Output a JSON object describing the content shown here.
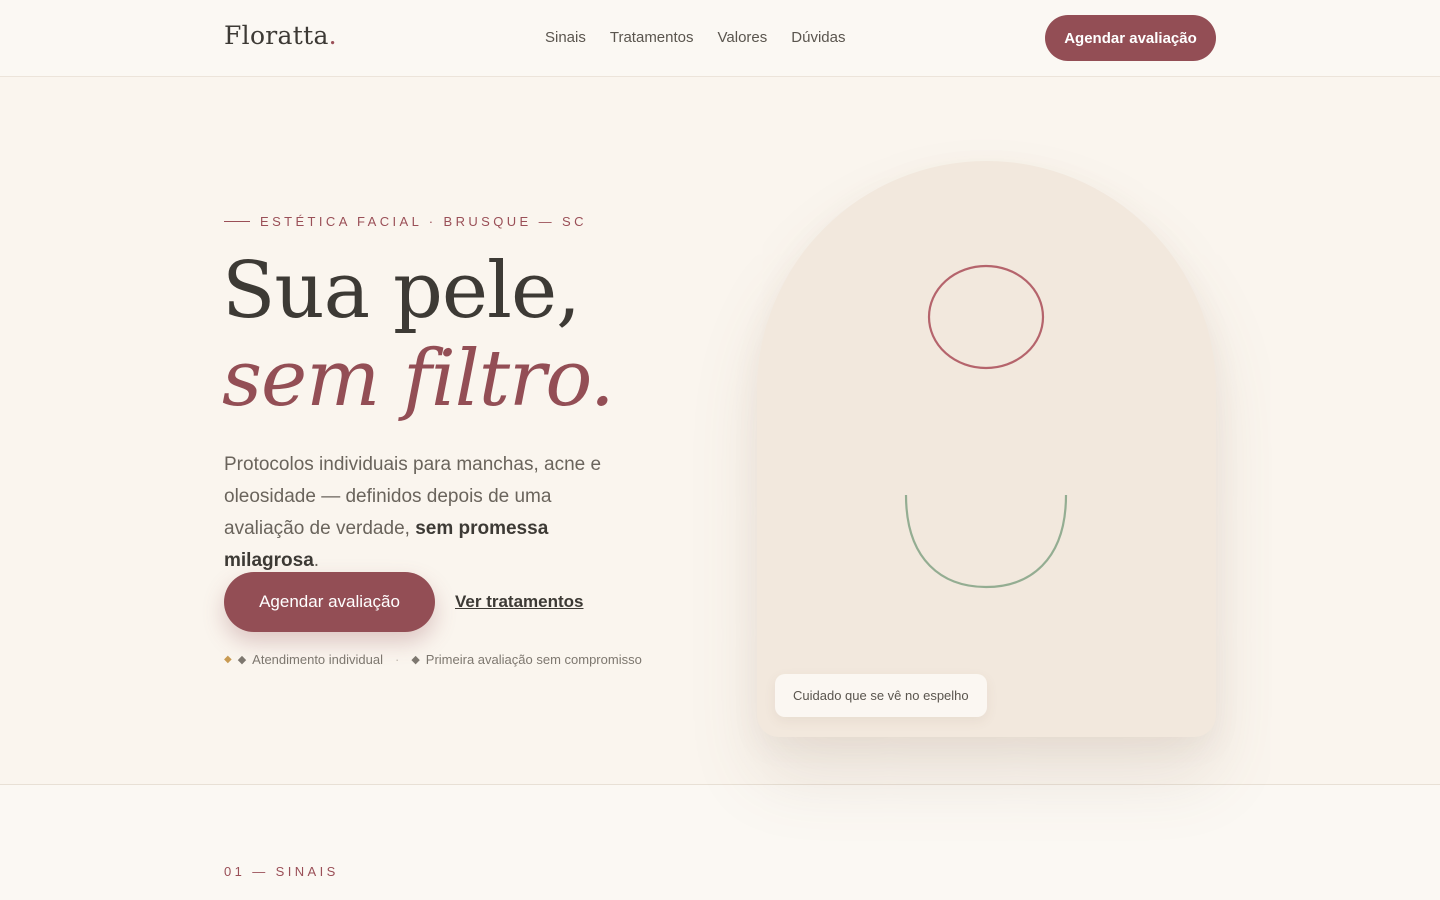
{
  "header": {
    "logo": "Floratta",
    "logo_dot": ".",
    "nav": [
      "Sinais",
      "Tratamentos",
      "Valores",
      "Dúvidas"
    ],
    "cta_label": "Agendar avaliação"
  },
  "hero": {
    "eyebrow": "ESTÉTICA FACIAL · BRUSQUE — SC",
    "headline_line1": "Sua pele,",
    "headline_line2": "sem filtro.",
    "lead_text": "Protocolos individuais para manchas, acne e oleosidade — definidos depois de uma avaliação de verdade, ",
    "lead_strong": "sem promessa milagrosa",
    "lead_end": ".",
    "cta_label": "Agendar avaliação",
    "secondary_label": "Ver tratamentos",
    "trust_items": [
      "Atendimento individual",
      "Primeira avaliação sem compromisso"
    ],
    "trust_separator": "·",
    "diamond": "◆"
  },
  "arch": {
    "badge": "Cuidado que se vê no espelho"
  },
  "next_section": {
    "label": "01 — SINAIS"
  },
  "colors": {
    "brand": "#934e55",
    "background": "#faf5ee",
    "arch": "#f2e8dd",
    "circle_stroke": "#b5646c",
    "smile_stroke": "#94ad92",
    "accent_gold": "#c89a52"
  }
}
